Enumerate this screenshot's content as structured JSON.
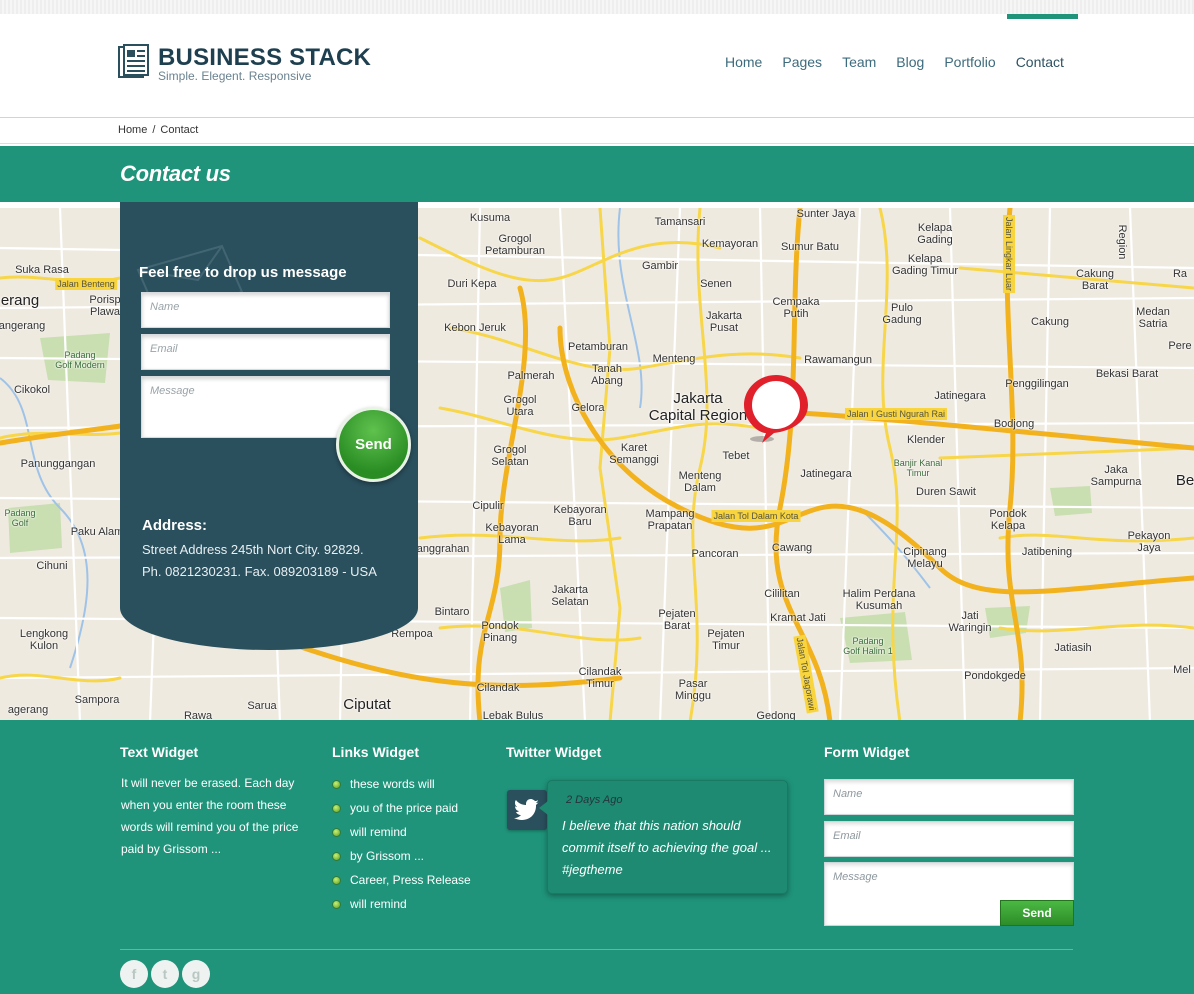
{
  "brand": {
    "title": "BUSINESS STACK",
    "tagline": "Simple. Elegent. Responsive"
  },
  "nav": {
    "items": [
      "Home",
      "Pages",
      "Team",
      "Blog",
      "Portfolio",
      "Contact"
    ],
    "active": "Contact"
  },
  "breadcrumb": {
    "home": "Home",
    "separator": "/",
    "current": "Contact"
  },
  "page_title": "Contact us",
  "contact_form": {
    "heading": "Feel free to drop us message",
    "name_placeholder": "Name",
    "email_placeholder": "Email",
    "message_placeholder": "Message",
    "send_label": "Send"
  },
  "address": {
    "heading": "Address:",
    "line1": "Street Address 245th Nort City. 92829.",
    "line2": "Ph. 0821230231. Fax. 089203189 - USA"
  },
  "map": {
    "labels": {
      "kusuma": "Kusuma",
      "tamansari": "Tamansari",
      "sunter_jaya": "Sunter Jaya",
      "kelapa_gading": "Kelapa\nGading",
      "grogol_petamburan": "Grogol\nPetamburan",
      "kemayoran": "Kemayoran",
      "sumur_batu": "Sumur Batu",
      "suka_rasa": "Suka Rasa",
      "jalan_benteng": "Jalan Benteng",
      "erang": "erang",
      "porisp": "Porisp\nPlawa",
      "duri_kepa": "Duri Kepa",
      "gambir": "Gambir",
      "senen": "Senen",
      "kelapa_gading_timur": "Kelapa\nGading Timur",
      "cakung_barat": "Cakung\nBarat",
      "angerang": "angerang",
      "kebon_jeruk": "Kebon Jeruk",
      "jakarta_pusat": "Jakarta\nPusat",
      "cempaka_putih": "Cempaka\nPutih",
      "pulo_gadung": "Pulo\nGadung",
      "cakung": "Cakung",
      "medan_satria": "Medan\nSatria",
      "padang_golf": "Padang\nGolf Modern",
      "petamburan": "Petamburan",
      "menteng": "Menteng",
      "rawamangun": "Rawamangun",
      "palmerah": "Palmerah",
      "tanah_abang": "Tanah\nAbang",
      "jakarta_capital": "Jakarta\nCapital Region",
      "cikokol": "Cikokol",
      "grogol_utara": "Grogol\nUtara",
      "gelora": "Gelora",
      "penggilingan": "Penggilingan",
      "bekasi_barat": "Bekasi Barat",
      "jatinegara_kaum": "Jatinegara",
      "bodjong": "Bodjong",
      "klender": "Klender",
      "panunggangan": "Panunggangan",
      "karet_semanggi": "Karet\nSemanggi",
      "tebet": "Tebet",
      "grogol_selatan": "Grogol\nSelatan",
      "banjir_kanal": "Banjir Kanal\nTimur",
      "jakasampurna": "Jaka\nSampurna",
      "menteng_dalam": "Menteng\nDalam",
      "jatinegara": "Jatinegara",
      "duren_sawit": "Duren Sawit",
      "paku_alam": "Paku Alam",
      "cipulir": "Cipulir",
      "kebayoran_baru": "Kebayoran\nBaru",
      "mampang": "Mampang\nPrapatan",
      "jalan_tol_dalam": "Jalan Tol Dalam Kota",
      "kebayoran_lama": "Kebayoran\nLama",
      "pondok_kelapa": "Pondok\nKelapa",
      "padang_golf_left": "Padang\nGolf",
      "cihuni": "Cihuni",
      "pancoran": "Pancoran",
      "cawang": "Cawang",
      "cipinang_melayu": "Cipinang\nMelayu",
      "jatibening": "Jatibening",
      "pekayon_jaya": "Pekayon\nJaya",
      "anggrahan": "anggrahan",
      "jakarta_selatan": "Jakarta\nSelatan",
      "cililitan": "Cililitan",
      "halim": "Halim Perdana\nKusumah",
      "pejaten_barat": "Pejaten\nBarat",
      "kramat_jati": "Kramat Jati",
      "jati_waringin": "Jati\nWaringin",
      "lengkong": "Lengkong\nKulon",
      "bintaro": "Bintaro",
      "pondok_pinang": "Pondok\nPinang",
      "rempoa": "Rempoa",
      "pejaten_timur": "Pejaten\nTimur",
      "padang_golf_halim": "Padang\nGolf Halim 1",
      "jatiasih": "Jatiasih",
      "cilandak_timur": "Cilandak\nTimur",
      "cilandak": "Cilandak",
      "pasar_minggu": "Pasar\nMinggu",
      "pondokgede": "Pondokgede",
      "sampora": "Sampora",
      "ciputat": "Ciputat",
      "sarua": "Sarua",
      "rawa": "Rawa",
      "lebak_bulus": "Lebak Bulus",
      "gedong": "Gedong",
      "agerang": "agerang",
      "be": "Be",
      "perum": "Pere",
      "medan": "Mel",
      "jalan_gusti": "Jalan I Gusti Ngurah Rai",
      "jalan_tol_jagorawi": "Jalan Tol Jagorawi",
      "tingkar_luar": "Jalan Lingkar Luar",
      "region": "Region",
      "ra_label": "Ra"
    }
  },
  "footer": {
    "text_widget": {
      "title": "Text Widget",
      "body": "It will never be erased. Each day when you enter the room these words will remind you of the price paid by Grissom ..."
    },
    "links_widget": {
      "title": "Links Widget",
      "items": [
        "these words will",
        "you of the price paid",
        "will remind",
        "by Grissom ...",
        "Career, Press Release",
        "will remind"
      ]
    },
    "twitter_widget": {
      "title": "Twitter Widget",
      "time": "2 Days Ago",
      "text": "I believe that this nation should commit itself to achieving the goal ... #jegtheme"
    },
    "form_widget": {
      "title": "Form Widget",
      "name_placeholder": "Name",
      "email_placeholder": "Email",
      "message_placeholder": "Message",
      "send_label": "Send"
    },
    "social": [
      "f",
      "t",
      "g"
    ]
  },
  "colors": {
    "accent": "#1f947a",
    "panel": "#2a4f5d",
    "marker": "#e0212b",
    "send_green": "#2a8d24"
  }
}
